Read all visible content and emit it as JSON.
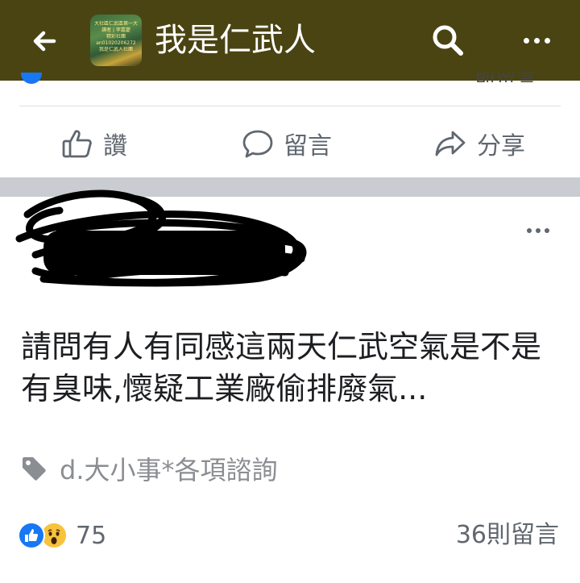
{
  "header": {
    "group_name": "我是仁武人",
    "thumbnail_lines": [
      "大社區仁武區第一大",
      "讀者 | 李嘉慶",
      "精彩社團",
      "an01020206272",
      "我是仁武人社團"
    ],
    "bg_color": "#4a4413",
    "icons": [
      "back-arrow-icon",
      "search-icon",
      "more-horizontal-icon"
    ]
  },
  "prev_post_actions": {
    "like_label": "讚",
    "comment_label": "留言",
    "share_label": "分享",
    "peek_text": "則留言"
  },
  "post": {
    "author_redacted": true,
    "body": "請問有人有同感這兩天仁武空氣是不是有臭味,懷疑工業廠偷排廢氣...",
    "topic_tag": "d.大小事*各項諮詢",
    "reaction_count": "75",
    "comment_count": "36則留言",
    "reactions": [
      "like",
      "wow"
    ]
  },
  "colors": {
    "accent": "#1877f2",
    "muted_text": "#606770",
    "separator": "#c9ccd1"
  }
}
